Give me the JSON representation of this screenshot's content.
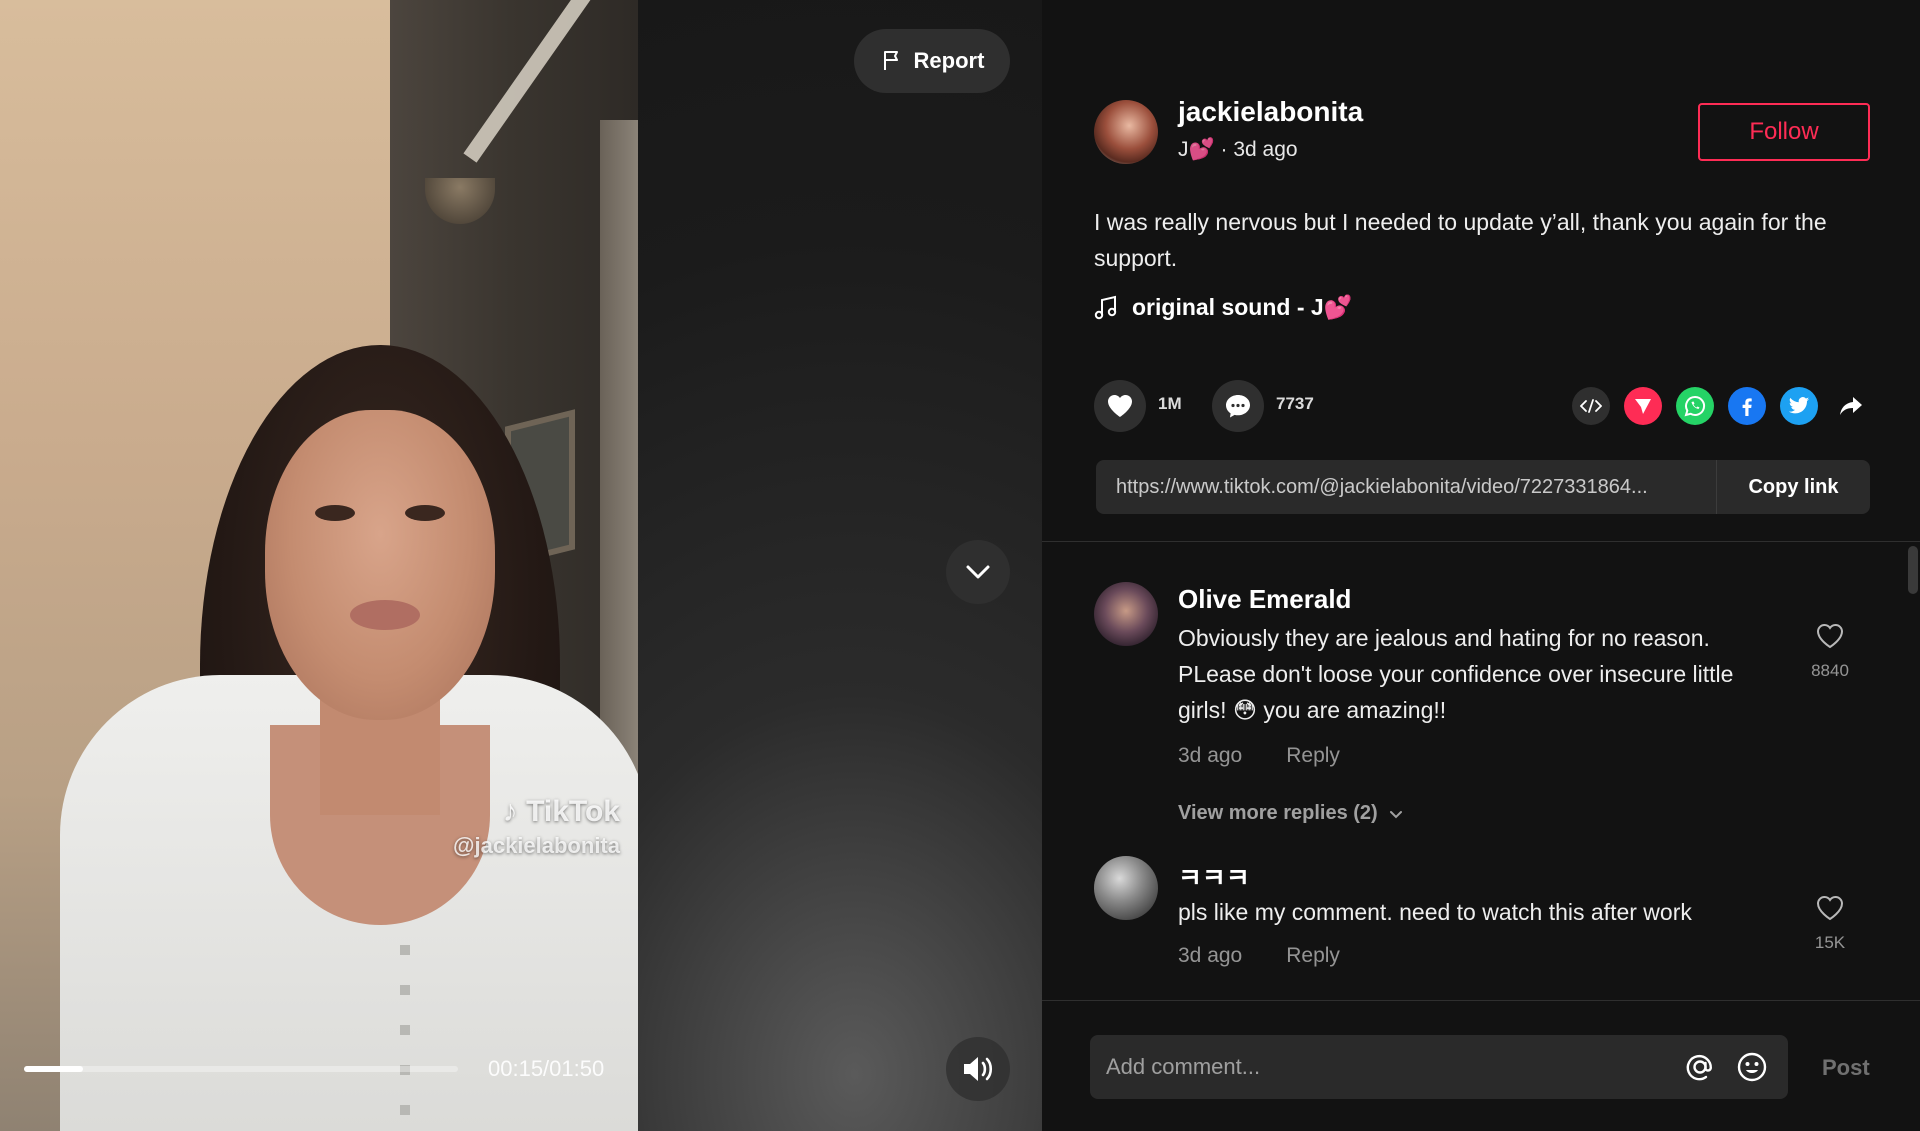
{
  "video": {
    "watermark_brand": "TikTok",
    "watermark_handle": "@jackielabonita",
    "time_display": "00:15/01:50",
    "progress_fraction": 0.136,
    "report_label": "Report"
  },
  "author": {
    "username": "jackielabonita",
    "nickname": "J💕",
    "posted": " · 3d ago",
    "follow_label": "Follow"
  },
  "post": {
    "description": "I was really nervous but I needed to update y’all, thank you again for the support.",
    "music": "original sound - J💕"
  },
  "stats": {
    "likes": "1M",
    "comments": "7737"
  },
  "share": {
    "icons": [
      "embed-icon",
      "send-icon",
      "whatsapp-icon",
      "facebook-icon",
      "twitter-icon",
      "share-arrow-icon"
    ],
    "colors": {
      "send": "#fe2c55",
      "whatsapp": "#25d366",
      "facebook": "#1877f2",
      "twitter": "#1da1f2"
    }
  },
  "link": {
    "url": "https://www.tiktok.com/@jackielabonita/video/7227331864...",
    "copy_label": "Copy link"
  },
  "comments": [
    {
      "name": "Olive Emerald",
      "text": "Obviously they are jealous and hating for no reason. PLease don't loose your confidence over insecure little girls! 😳 you are amazing!!",
      "time": "3d ago",
      "reply": "Reply",
      "likes": "8840",
      "view_more": "View more replies (2)"
    },
    {
      "name": "ㅋㅋㅋ",
      "text": "pls like my comment. need to watch this after work",
      "time": "3d ago",
      "reply": "Reply",
      "likes": "15K"
    }
  ],
  "composer": {
    "placeholder": "Add comment...",
    "post_label": "Post"
  },
  "theme": {
    "accent": "#fe2c55",
    "background": "#121212"
  }
}
